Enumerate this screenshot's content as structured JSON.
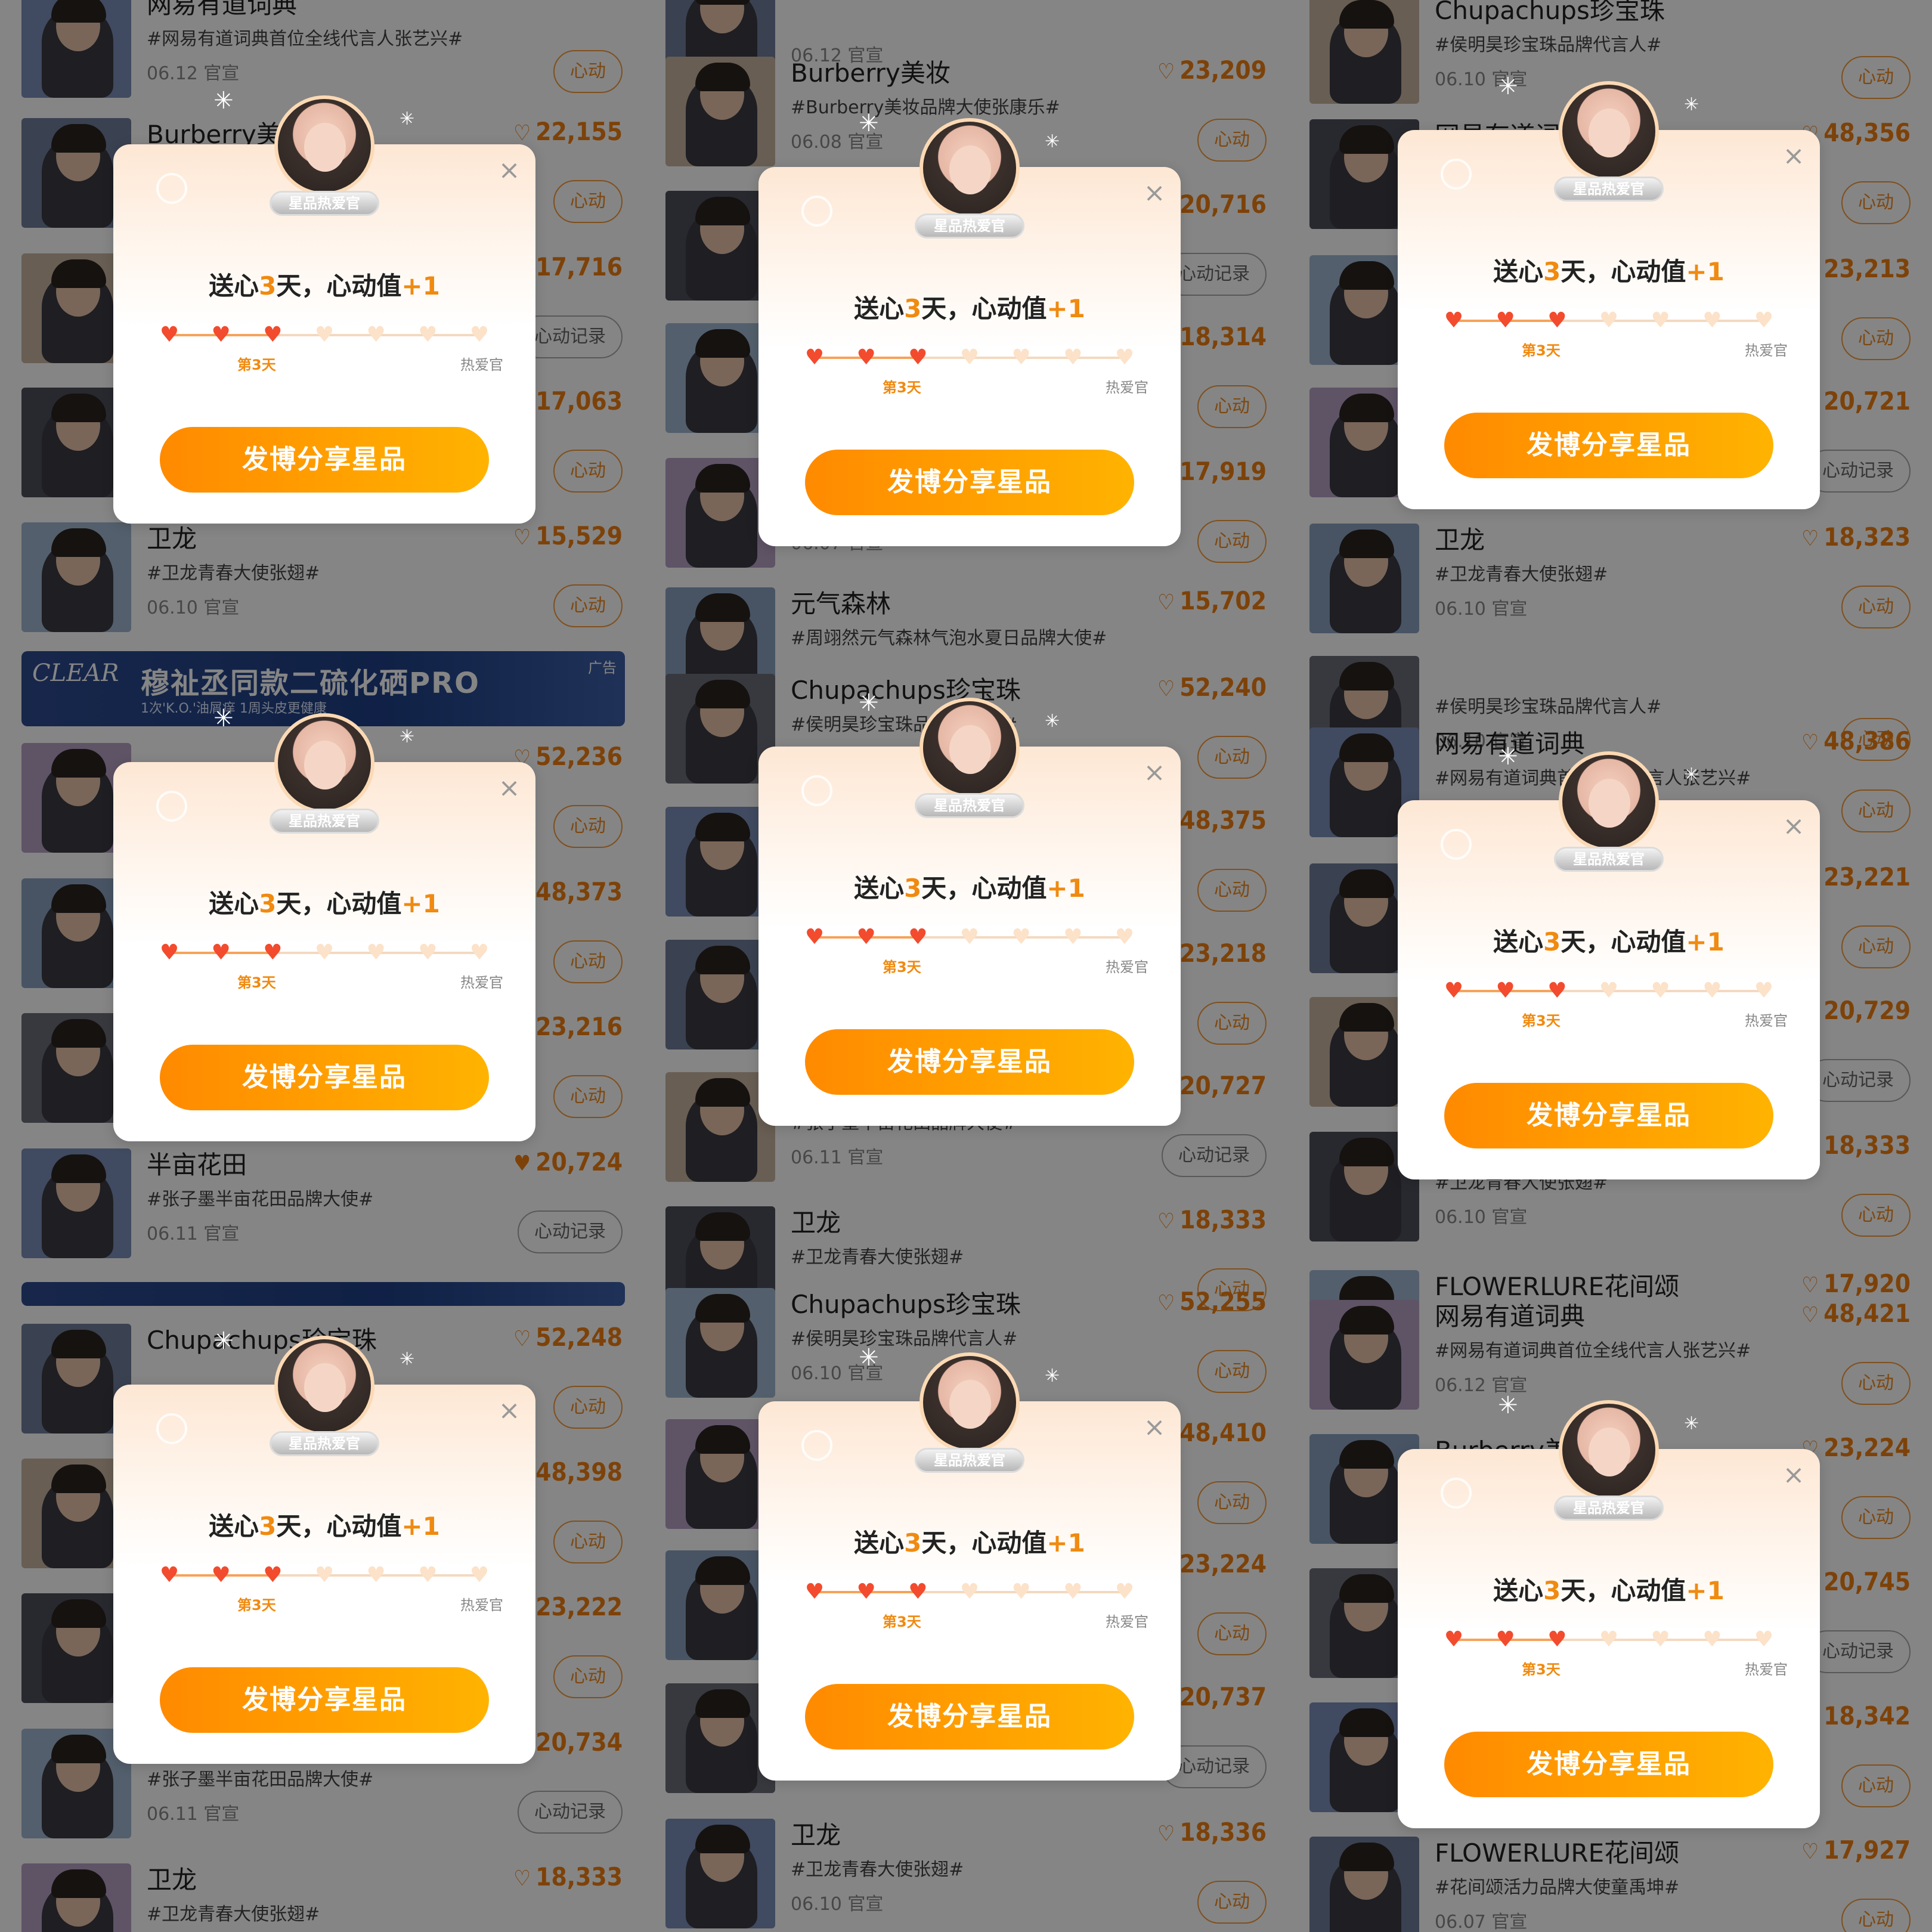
{
  "columns": [
    {
      "items": [
        {
          "title": "网易有道词典",
          "tag": "#网易有道词典首位全线代言人张艺兴#",
          "meta": "06.12 官宣",
          "count": "",
          "liked": false,
          "button": "心动"
        },
        {
          "title": "Burberry美妆",
          "tag": "",
          "meta": "",
          "count": "22,155",
          "liked": false,
          "button": "心动"
        },
        {
          "title": "",
          "tag": "",
          "meta": "",
          "count": "17,716",
          "liked": true,
          "button": "心动记录"
        },
        {
          "title": "",
          "tag": "",
          "meta": "",
          "count": "17,063",
          "liked": false,
          "button": "心动"
        },
        {
          "title": "卫龙",
          "tag": "#卫龙青春大使张翅#",
          "meta": "06.10 官宣",
          "count": "15,529",
          "liked": false,
          "button": "心动"
        },
        {
          "title": "",
          "tag": "",
          "meta": "",
          "count": "52,236",
          "liked": false,
          "button": "心动"
        },
        {
          "title": "",
          "tag": "",
          "meta": "",
          "count": "48,373",
          "liked": false,
          "button": "心动"
        },
        {
          "title": "",
          "tag": "",
          "meta": "",
          "count": "23,216",
          "liked": false,
          "button": "心动"
        },
        {
          "title": "半亩花田",
          "tag": "#张子墨半亩花田品牌大使#",
          "meta": "06.11 官宣",
          "count": "20,724",
          "liked": true,
          "button": "心动记录"
        },
        {
          "title": "Chupachups珍宝珠",
          "tag": "",
          "meta": "",
          "count": "52,248",
          "liked": false,
          "button": "心动"
        },
        {
          "title": "",
          "tag": "",
          "meta": "",
          "count": "48,398",
          "liked": false,
          "button": "心动"
        },
        {
          "title": "",
          "tag": "",
          "meta": "",
          "count": "23,222",
          "liked": false,
          "button": "心动"
        },
        {
          "title": "",
          "tag": "#张子墨半亩花田品牌大使#",
          "meta": "06.11 官宣",
          "count": "20,734",
          "liked": true,
          "button": "心动记录"
        },
        {
          "title": "卫龙",
          "tag": "#卫龙青春大使张翅#",
          "meta": "",
          "count": "18,333",
          "liked": false,
          "button": ""
        }
      ],
      "ads": [
        {
          "logo": "CLEAR",
          "text": "穆祉丞同款二硫化硒PRO",
          "sub": "1次'K.O.'油屑痒 1周头皮更健康",
          "tag": "广告"
        },
        {
          "logo": "",
          "text": "",
          "sub": "",
          "tag": ""
        }
      ]
    },
    {
      "items": [
        {
          "title": "",
          "tag": "",
          "meta": "06.12 官宣",
          "count": "",
          "liked": false,
          "button": ""
        },
        {
          "title": "Burberry美妆",
          "tag": "#Burberry美妆品牌大使张康乐#",
          "meta": "06.08 官宣",
          "count": "23,209",
          "liked": false,
          "button": "心动"
        },
        {
          "title": "",
          "tag": "",
          "meta": "",
          "count": "20,716",
          "liked": true,
          "button": "心动记录"
        },
        {
          "title": "",
          "tag": "",
          "meta": "",
          "count": "18,314",
          "liked": false,
          "button": "心动"
        },
        {
          "title": "",
          "tag": "",
          "meta": "06.07 官宣",
          "count": "17,919",
          "liked": false,
          "button": "心动"
        },
        {
          "title": "元气森林",
          "tag": "#周翊然元气森林气泡水夏日品牌大使#",
          "meta": "",
          "count": "15,702",
          "liked": false,
          "button": ""
        },
        {
          "title": "Chupachups珍宝珠",
          "tag": "#侯明昊珍宝珠品牌代言人#",
          "meta": "",
          "count": "52,240",
          "liked": false,
          "button": "心动"
        },
        {
          "title": "",
          "tag": "",
          "meta": "",
          "count": "48,375",
          "liked": false,
          "button": "心动"
        },
        {
          "title": "",
          "tag": "",
          "meta": "",
          "count": "23,218",
          "liked": false,
          "button": "心动"
        },
        {
          "title": "",
          "tag": "#张子墨半亩花田品牌大使#",
          "meta": "06.11 官宣",
          "count": "20,727",
          "liked": true,
          "button": "心动记录"
        },
        {
          "title": "卫龙",
          "tag": "#卫龙青春大使张翅#",
          "meta": "",
          "count": "18,333",
          "liked": false,
          "button": "心动"
        },
        {
          "title": "Chupachups珍宝珠",
          "tag": "#侯明昊珍宝珠品牌代言人#",
          "meta": "06.10 官宣",
          "count": "52,255",
          "liked": false,
          "button": "心动"
        },
        {
          "title": "",
          "tag": "",
          "meta": "",
          "count": "48,410",
          "liked": false,
          "button": "心动"
        },
        {
          "title": "",
          "tag": "",
          "meta": "",
          "count": "23,224",
          "liked": false,
          "button": "心动"
        },
        {
          "title": "",
          "tag": "",
          "meta": "06.11 官宣",
          "count": "20,737",
          "liked": true,
          "button": "心动记录"
        },
        {
          "title": "卫龙",
          "tag": "#卫龙青春大使张翅#",
          "meta": "06.10 官宣",
          "count": "18,336",
          "liked": false,
          "button": "心动"
        }
      ]
    },
    {
      "items": [
        {
          "title": "Chupachups珍宝珠",
          "tag": "#侯明昊珍宝珠品牌代言人#",
          "meta": "06.10 官宣",
          "count": "",
          "liked": false,
          "button": "心动"
        },
        {
          "title": "网易有道词典",
          "tag": "",
          "meta": "",
          "count": "48,356",
          "liked": false,
          "button": "心动"
        },
        {
          "title": "",
          "tag": "",
          "meta": "",
          "count": "23,213",
          "liked": false,
          "button": "心动"
        },
        {
          "title": "",
          "tag": "",
          "meta": "",
          "count": "20,721",
          "liked": true,
          "button": "心动记录"
        },
        {
          "title": "卫龙",
          "tag": "#卫龙青春大使张翅#",
          "meta": "06.10 官宣",
          "count": "18,323",
          "liked": false,
          "button": "心动"
        },
        {
          "title": "",
          "tag": "#侯明昊珍宝珠品牌代言人#",
          "meta": "06.10 官宣",
          "count": "",
          "liked": false,
          "button": "心动"
        },
        {
          "title": "网易有道词典",
          "tag": "#网易有道词典首位全线代言人张艺兴#",
          "meta": "",
          "count": "48,386",
          "liked": false,
          "button": "心动"
        },
        {
          "title": "",
          "tag": "",
          "meta": "",
          "count": "23,221",
          "liked": false,
          "button": "心动"
        },
        {
          "title": "",
          "tag": "",
          "meta": "",
          "count": "20,729",
          "liked": true,
          "button": "心动记录"
        },
        {
          "title": "",
          "tag": "#卫龙青春大使张翅#",
          "meta": "06.10 官宣",
          "count": "18,333",
          "liked": false,
          "button": "心动"
        },
        {
          "title": "FLOWERLURE花间颂",
          "tag": "",
          "meta": "",
          "count": "17,920",
          "liked": false,
          "button": ""
        },
        {
          "title": "网易有道词典",
          "tag": "#网易有道词典首位全线代言人张艺兴#",
          "meta": "06.12 官宣",
          "count": "48,421",
          "liked": false,
          "button": "心动"
        },
        {
          "title": "Burberry美妆",
          "tag": "",
          "meta": "",
          "count": "23,224",
          "liked": false,
          "button": "心动"
        },
        {
          "title": "",
          "tag": "",
          "meta": "",
          "count": "20,745",
          "liked": true,
          "button": "心动记录"
        },
        {
          "title": "",
          "tag": "",
          "meta": "",
          "count": "18,342",
          "liked": false,
          "button": "心动"
        },
        {
          "title": "FLOWERLURE花间颂",
          "tag": "#花间颂活力品牌大使童禹坤#",
          "meta": "06.07 官宣",
          "count": "17,927",
          "liked": false,
          "button": "心动"
        }
      ]
    }
  ],
  "modal": {
    "badge": "星品热爱官",
    "title_prefix": "送心",
    "title_days": "3",
    "title_mid": "天，心动值",
    "title_plus": "+1",
    "progress_done": 3,
    "progress_total": 7,
    "label_day": "第3天",
    "label_end": "热爱官",
    "button": "发博分享星品",
    "close": "×"
  },
  "colors": {
    "accent": "#f08a10",
    "heart_on": "#f24b2e",
    "heart_off": "#fce2c9",
    "button_from": "#ff8a00",
    "button_to": "#ffb300"
  }
}
